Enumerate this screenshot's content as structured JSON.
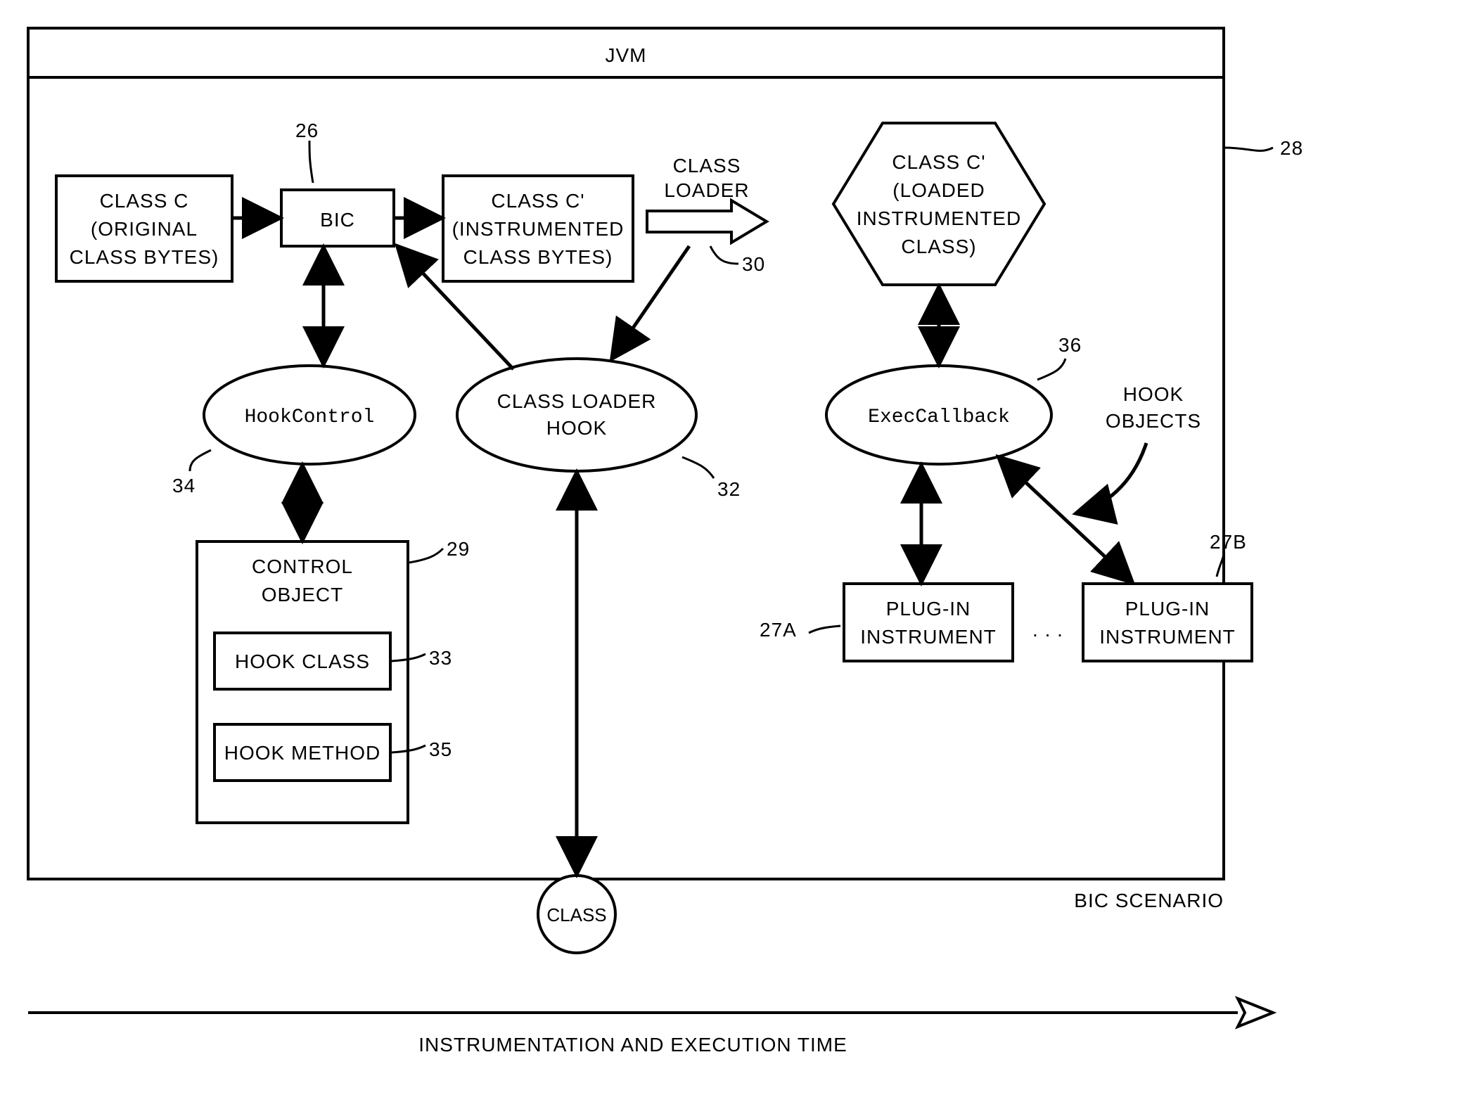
{
  "title": "JVM",
  "outer_label": "BIC SCENARIO",
  "timeline": "INSTRUMENTATION AND EXECUTION TIME",
  "bottom_circle": "CLASS",
  "refs": {
    "bic": "26",
    "jvm_box": "28",
    "control_obj": "29",
    "class_loader": "30",
    "clh": "32",
    "hook_class": "33",
    "hook_control": "34",
    "hook_method": "35",
    "exec_cb": "36",
    "plugin_a": "27A",
    "plugin_b": "27B"
  },
  "nodes": {
    "class_c": {
      "l1": "CLASS C",
      "l2": "(ORIGINAL",
      "l3": "CLASS BYTES)"
    },
    "bic": {
      "l1": "BIC"
    },
    "class_cp": {
      "l1": "CLASS C'",
      "l2": "(INSTRUMENTED",
      "l3": "CLASS BYTES)"
    },
    "loader": {
      "l1": "CLASS",
      "l2": "LOADER"
    },
    "hexagon": {
      "l1": "CLASS C'",
      "l2": "(LOADED",
      "l3": "INSTRUMENTED",
      "l4": "CLASS)"
    },
    "hook_ctrl": {
      "l1": "HookControl"
    },
    "clh": {
      "l1": "CLASS LOADER",
      "l2": "HOOK"
    },
    "exec_cb": {
      "l1": "ExecCallback"
    },
    "ctrl_obj": {
      "l1": "CONTROL",
      "l2": "OBJECT"
    },
    "hook_class": {
      "l1": "HOOK CLASS"
    },
    "hook_meth": {
      "l1": "HOOK METHOD"
    },
    "plugin_a": {
      "l1": "PLUG-IN",
      "l2": "INSTRUMENT"
    },
    "plugin_b": {
      "l1": "PLUG-IN",
      "l2": "INSTRUMENT"
    },
    "hook_obj": {
      "l1": "HOOK",
      "l2": "OBJECTS"
    },
    "dots": ". . ."
  }
}
